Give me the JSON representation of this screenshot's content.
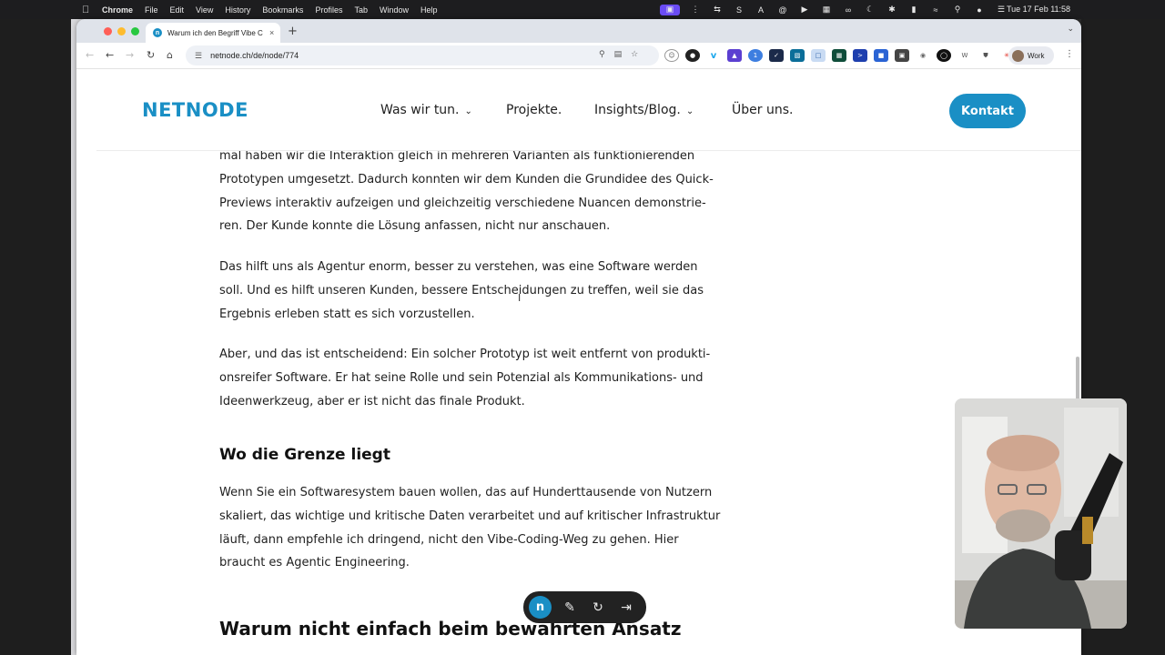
{
  "menubar": {
    "app": "Chrome",
    "items": [
      "File",
      "Edit",
      "View",
      "History",
      "Bookmarks",
      "Profiles",
      "Tab",
      "Window",
      "Help"
    ],
    "clock": "Tue 17 Feb  11:58"
  },
  "browser": {
    "tab_title": "Warum ich den Begriff Vibe C",
    "url": "netnode.ch/de/node/774",
    "profile_label": "Work"
  },
  "site": {
    "logo": "NETNODE",
    "brand_color": "#1a8fc5",
    "nav": [
      "Was wir tun.",
      "Projekte.",
      "Insights/Blog.",
      "Über uns."
    ],
    "cta": "Kontakt"
  },
  "article": {
    "para1": [
      "mal haben wir die Interaktion gleich in mehreren Varianten als funktionierenden",
      "Prototypen umgesetzt. Dadurch konnten wir dem Kunden die Grundidee des Quick-",
      "Previews interaktiv aufzeigen und gleichzeitig verschiedene Nuancen demonstrie-",
      "ren. Der Kunde konnte die Lösung anfassen, nicht nur anschauen."
    ],
    "para2": [
      "Das hilft uns als Agentur enorm, besser zu verstehen, was eine Software werden",
      "soll. Und es hilft unseren Kunden, bessere Entscheidungen zu treffen, weil sie das",
      "Ergebnis erleben statt es sich vorzustellen."
    ],
    "para3": [
      "Aber, und das ist entscheidend: Ein solcher Prototyp ist weit entfernt von produkti-",
      "onsreifer Software. Er hat seine Rolle und sein Potenzial als Kommunikations- und",
      "Ideenwerkzeug, aber er ist nicht das finale Produkt."
    ],
    "heading1": "Wo die Grenze liegt",
    "para4": [
      "Wenn Sie ein Softwaresystem bauen wollen, das auf Hunderttausende von Nutzern",
      "skaliert, das wichtige und kritische Daten verarbeitet und auf kritischer Infrastruktur",
      "läuft, dann empfehle ich dringend, nicht den Vibe-Coding-Weg zu gehen. Hier",
      "braucht es Agentic Engineering."
    ],
    "heading2": "Warum nicht einfach beim bewährten Ansatz"
  },
  "floating_toolbar": {
    "logo": "n",
    "icons": [
      "edit-icon",
      "refresh-icon",
      "exit-icon"
    ]
  }
}
